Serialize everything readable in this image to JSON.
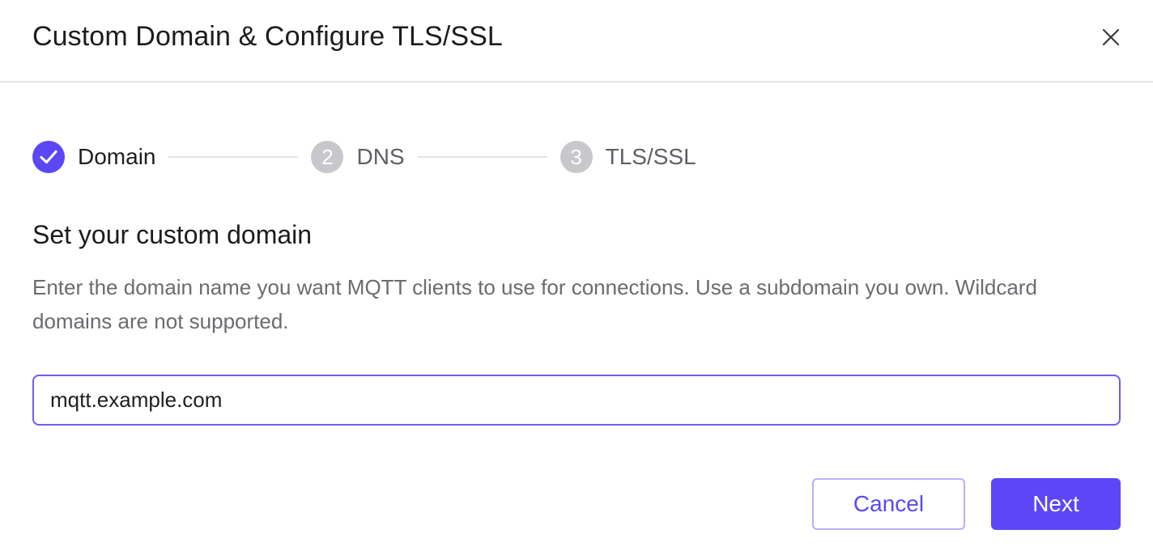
{
  "dialog": {
    "title": "Custom Domain & Configure TLS/SSL",
    "close_icon": "close-icon"
  },
  "stepper": {
    "steps": [
      {
        "number": "1",
        "label": "Domain",
        "status": "completed",
        "icon": "check-icon"
      },
      {
        "number": "2",
        "label": "DNS",
        "status": "pending"
      },
      {
        "number": "3",
        "label": "TLS/SSL",
        "status": "pending"
      }
    ]
  },
  "section": {
    "title": "Set your custom domain",
    "description": "Enter the domain name you want MQTT clients to use for connections. Use a subdomain you own. Wildcard domains are not supported."
  },
  "domain_input": {
    "value": "mqtt.example.com",
    "placeholder": ""
  },
  "footer": {
    "cancel_label": "Cancel",
    "next_label": "Next"
  },
  "colors": {
    "accent": "#5b47f5",
    "step_pending": "#c8c8cc",
    "text_primary": "#1c1c1e",
    "text_secondary": "#6b6b70"
  }
}
